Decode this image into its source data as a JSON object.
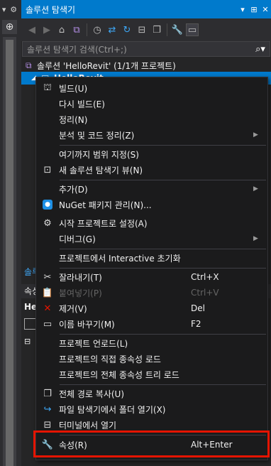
{
  "panel": {
    "title": "솔루션 탐색기",
    "title_buttons": [
      "▾",
      "⊞",
      "✕"
    ]
  },
  "left_strip": {
    "icons": [
      "▾",
      "⚙"
    ],
    "pin_button": "⊕"
  },
  "toolbar": {
    "icons": [
      "back-icon",
      "forward-icon",
      "home-icon",
      "vs-switch-icon",
      "history-icon",
      "sync-icon",
      "refresh-icon",
      "collapse-all-icon",
      "show-all-files-icon",
      "properties-icon",
      "preview-icon"
    ]
  },
  "search": {
    "placeholder": "솔루션 탐색기 검색(Ctrl+;)",
    "icon": "search-icon"
  },
  "tree": {
    "solution_label": "솔루션 'HelloRevit' (1/1개 프로젝트)",
    "project_label": "HelloRevit"
  },
  "lower_panel": {
    "tab_partial": "솔루",
    "properties_header_partial": "속성",
    "object_partial": "He"
  },
  "context_menu": {
    "items": [
      {
        "label": "빌드(U)",
        "shortcut": "",
        "icon": "build-icon",
        "submenu": false,
        "enabled": true
      },
      {
        "label": "다시 빌드(E)",
        "shortcut": "",
        "icon": "",
        "submenu": false,
        "enabled": true
      },
      {
        "label": "정리(N)",
        "shortcut": "",
        "icon": "",
        "submenu": false,
        "enabled": true
      },
      {
        "label": "분석 및 코드 정리(Z)",
        "shortcut": "",
        "icon": "",
        "submenu": true,
        "enabled": true
      },
      {
        "label": "여기까지 범위 지정(S)",
        "shortcut": "",
        "icon": "",
        "submenu": false,
        "enabled": true
      },
      {
        "label": "새 솔루션 탐색기 뷰(N)",
        "shortcut": "",
        "icon": "new-view-icon",
        "submenu": false,
        "enabled": true
      },
      {
        "label": "추가(D)",
        "shortcut": "",
        "icon": "",
        "submenu": true,
        "enabled": true
      },
      {
        "label": "NuGet 패키지 관리(N)...",
        "shortcut": "",
        "icon": "nuget-icon",
        "submenu": false,
        "enabled": true
      },
      {
        "label": "시작 프로젝트로 설정(A)",
        "shortcut": "",
        "icon": "gear-icon",
        "submenu": false,
        "enabled": true
      },
      {
        "label": "디버그(G)",
        "shortcut": "",
        "icon": "",
        "submenu": true,
        "enabled": true
      },
      {
        "label": "프로젝트에서 Interactive 초기화",
        "shortcut": "",
        "icon": "",
        "submenu": false,
        "enabled": true
      },
      {
        "label": "잘라내기(T)",
        "shortcut": "Ctrl+X",
        "icon": "scissors-icon",
        "submenu": false,
        "enabled": true
      },
      {
        "label": "붙여넣기(P)",
        "shortcut": "Ctrl+V",
        "icon": "paste-icon",
        "submenu": false,
        "enabled": false
      },
      {
        "label": "제거(V)",
        "shortcut": "Del",
        "icon": "delete-icon",
        "submenu": false,
        "enabled": true
      },
      {
        "label": "이름 바꾸기(M)",
        "shortcut": "F2",
        "icon": "rename-icon",
        "submenu": false,
        "enabled": true
      },
      {
        "label": "프로젝트 언로드(L)",
        "shortcut": "",
        "icon": "",
        "submenu": false,
        "enabled": true
      },
      {
        "label": "프로젝트의 직접 종속성 로드",
        "shortcut": "",
        "icon": "",
        "submenu": false,
        "enabled": true
      },
      {
        "label": "프로젝트의 전체 종속성 트리 로드",
        "shortcut": "",
        "icon": "",
        "submenu": false,
        "enabled": true
      },
      {
        "label": "전체 경로 복사(U)",
        "shortcut": "",
        "icon": "copy-icon",
        "submenu": false,
        "enabled": true
      },
      {
        "label": "파일 탐색기에서 폴더 열기(X)",
        "shortcut": "",
        "icon": "open-folder-icon",
        "submenu": false,
        "enabled": true
      },
      {
        "label": "터미널에서 열기",
        "shortcut": "",
        "icon": "terminal-icon",
        "submenu": false,
        "enabled": true
      },
      {
        "label": "속성(R)",
        "shortcut": "Alt+Enter",
        "icon": "wrench-icon",
        "submenu": false,
        "enabled": true
      }
    ]
  },
  "colors": {
    "accent": "#007acc",
    "menu_bg": "#1b1b1c",
    "highlight_border": "#e51400"
  }
}
